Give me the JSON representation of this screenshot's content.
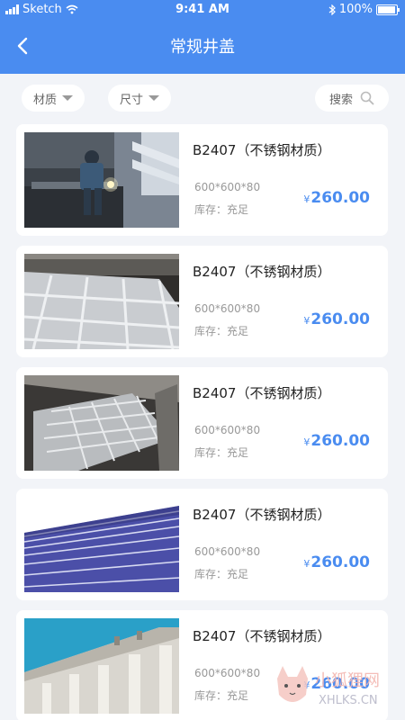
{
  "status_bar": {
    "carrier": "Sketch",
    "time": "9:41 AM",
    "battery": "100%"
  },
  "nav": {
    "title": "常规井盖",
    "back_icon": "chevron-left-icon"
  },
  "filters": {
    "material_label": "材质",
    "size_label": "尺寸",
    "search_label": "搜索"
  },
  "products": [
    {
      "name": "B2407（不锈钢材质）",
      "spec": "600*600*80",
      "stock": "库存：充足",
      "currency": "¥",
      "price": "260.00",
      "image": "welder-workshop"
    },
    {
      "name": "B2407（不锈钢材质）",
      "spec": "600*600*80",
      "stock": "库存：充足",
      "currency": "¥",
      "price": "260.00",
      "image": "grid-cover"
    },
    {
      "name": "B2407（不锈钢材质）",
      "spec": "600*600*80",
      "stock": "库存：充足",
      "currency": "¥",
      "price": "260.00",
      "image": "grid-cover-dark"
    },
    {
      "name": "B2407（不锈钢材质）",
      "spec": "600*600*80",
      "stock": "库存：充足",
      "currency": "¥",
      "price": "260.00",
      "image": "blue-facade"
    },
    {
      "name": "B2407（不锈钢材质）",
      "spec": "600*600*80",
      "stock": "库存：充足",
      "currency": "¥",
      "price": "260.00",
      "image": "classical-building"
    }
  ],
  "watermark": {
    "text_cn": "小狐狸网",
    "text_en": "XHLKS.CN"
  },
  "colors": {
    "header": "#4a8cf0",
    "price": "#4a8cf0",
    "background": "#f2f4f8"
  }
}
